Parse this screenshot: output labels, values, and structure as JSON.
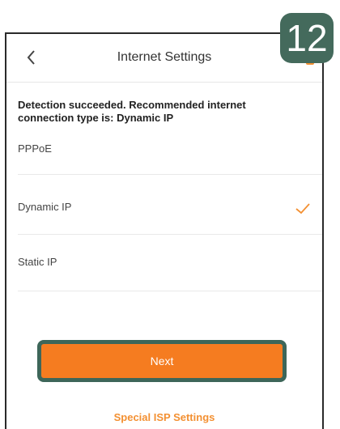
{
  "header": {
    "title": "Internet Settings"
  },
  "detection_message": "Detection succeeded. Recommended internet connection type is: Dynamic IP",
  "options": [
    {
      "label": "PPPoE",
      "selected": false
    },
    {
      "label": "Dynamic IP",
      "selected": true
    },
    {
      "label": "Static IP",
      "selected": false
    }
  ],
  "next_button": "Next",
  "special_link": "Special ISP Settings",
  "step_badge": "12",
  "colors": {
    "accent": "#f57c20",
    "badge": "#446a5c"
  }
}
